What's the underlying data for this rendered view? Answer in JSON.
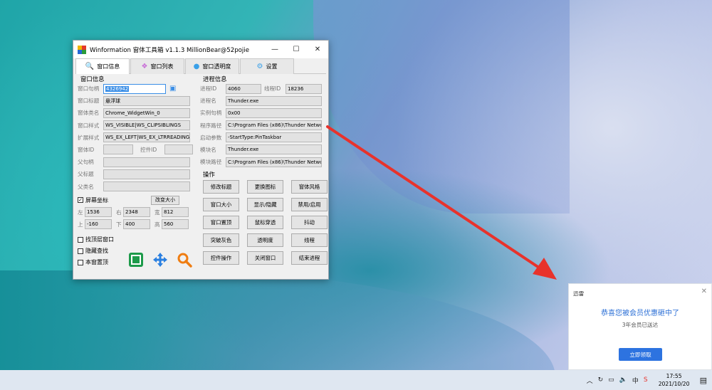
{
  "window": {
    "title": "Winformation 窗体工具箱 v1.1.3  MillionBear@52pojie",
    "controls": {
      "minimize": "—",
      "maximize": "☐",
      "close": "✕"
    }
  },
  "tabs": [
    {
      "label": "窗口信息",
      "icon": "🔍"
    },
    {
      "label": "窗口列表",
      "icon": "❖"
    },
    {
      "label": "窗口透明度",
      "icon": "●"
    },
    {
      "label": "设置",
      "icon": "⚙"
    }
  ],
  "window_info": {
    "group_title": "窗口信息",
    "handle": {
      "label": "窗口句柄",
      "value": "4326942"
    },
    "title": {
      "label": "窗口标题",
      "value": "悬浮球"
    },
    "class": {
      "label": "窗体类名",
      "value": "Chrome_WidgetWin_0"
    },
    "style": {
      "label": "窗口样式",
      "value": "WS_VISIBLE|WS_CLIPSIBLINGS"
    },
    "ex_style": {
      "label": "扩展样式",
      "value": "WS_EX_LEFT|WS_EX_LTRREADING|"
    },
    "form_id": {
      "label": "窗体ID",
      "value": ""
    },
    "control_id": {
      "label": "控件ID",
      "value": ""
    },
    "parent_handle": {
      "label": "父句柄",
      "value": ""
    },
    "parent_title": {
      "label": "父标题",
      "value": ""
    },
    "parent_class": {
      "label": "父类名",
      "value": ""
    },
    "screen_coords": {
      "label": "屏幕坐标",
      "checked": true
    },
    "change_size": "改变大小",
    "left": {
      "label": "左",
      "value": "1536"
    },
    "right": {
      "label": "右",
      "value": "2348"
    },
    "width": {
      "label": "宽",
      "value": "812"
    },
    "top": {
      "label": "上",
      "value": "-160"
    },
    "bottom": {
      "label": "下",
      "value": "400"
    },
    "height": {
      "label": "高",
      "value": "560"
    }
  },
  "process_info": {
    "group_title": "进程信息",
    "pid": {
      "label": "进程ID",
      "value": "4060"
    },
    "tid": {
      "label": "线程ID",
      "value": "18236"
    },
    "name": {
      "label": "进程名",
      "value": "Thunder.exe"
    },
    "instance": {
      "label": "实例句柄",
      "value": "0x00"
    },
    "path": {
      "label": "程序路径",
      "value": "C:\\Program Files (x86)\\Thunder Networ"
    },
    "args": {
      "label": "启动参数",
      "value": "-StartType:PinTaskbar"
    },
    "module": {
      "label": "模块名",
      "value": "Thunder.exe"
    },
    "module_path": {
      "label": "模块路径",
      "value": "C:\\Program Files (x86)\\Thunder Networ"
    }
  },
  "operations": {
    "group_title": "操作",
    "buttons": [
      "修改标题",
      "更换图标",
      "窗体风格",
      "窗口大小",
      "显示/隐藏",
      "禁用/启用",
      "窗口置顶",
      "鼠标穿透",
      "抖动",
      "突破灰色",
      "透明度",
      "线程",
      "控件操作",
      "关闭窗口",
      "结束进程"
    ]
  },
  "options": [
    {
      "label": "找顶层窗口",
      "checked": false
    },
    {
      "label": "隐藏查找",
      "checked": false
    },
    {
      "label": "本窗置顶",
      "checked": false
    }
  ],
  "notification": {
    "app": "迅雷",
    "headline": "恭喜您被会员优惠砸中了",
    "sub": "3年会员已送达",
    "button": "立即领取",
    "close": "✕"
  },
  "taskbar": {
    "time": "17:55",
    "date": "2021/10/20"
  },
  "colors": {
    "accent": "#2d73e0",
    "arrow": "#e8322b",
    "selection": "#3a8ee6"
  }
}
